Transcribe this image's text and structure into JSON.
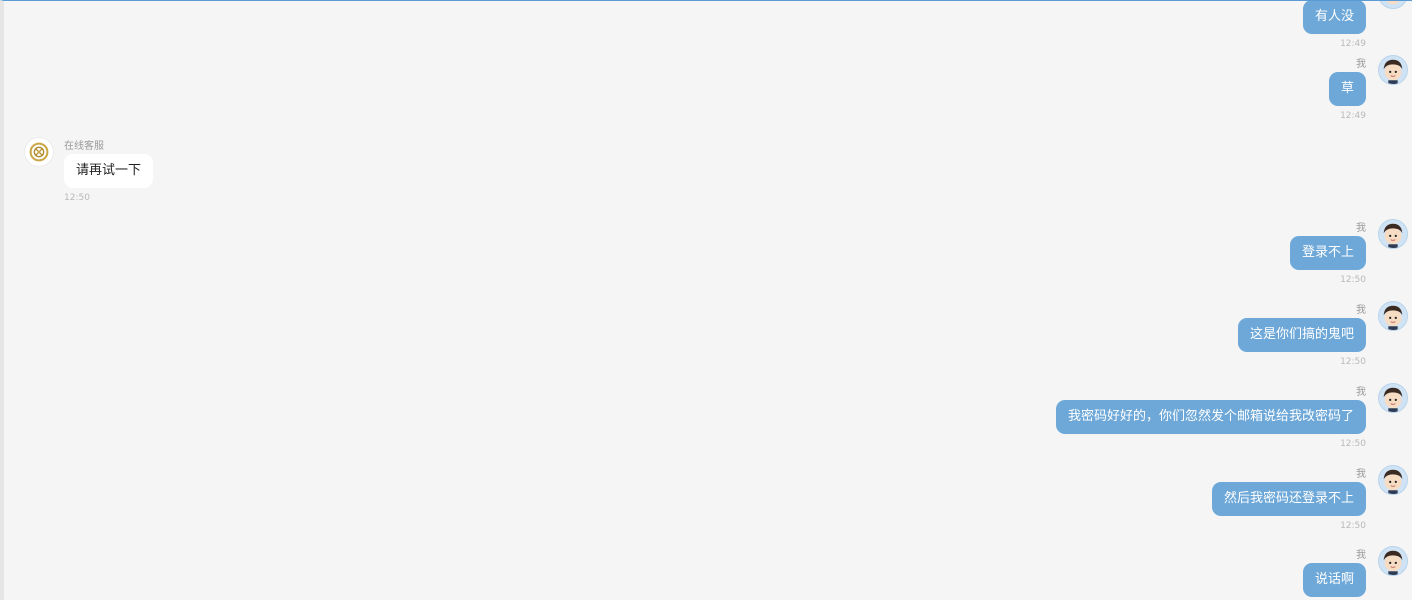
{
  "messages": [
    {
      "side": "out",
      "sender": "",
      "text": "有人没",
      "time": "12:49"
    },
    {
      "side": "out",
      "sender": "我",
      "text": "草",
      "time": "12:49"
    },
    {
      "side": "in",
      "sender": "在线客服",
      "text": "请再试一下",
      "time": "12:50"
    },
    {
      "side": "out",
      "sender": "我",
      "text": "登录不上",
      "time": "12:50"
    },
    {
      "side": "out",
      "sender": "我",
      "text": "这是你们搞的鬼吧",
      "time": "12:50"
    },
    {
      "side": "out",
      "sender": "我",
      "text": "我密码好好的，你们忽然发个邮箱说给我改密码了",
      "time": "12:50"
    },
    {
      "side": "out",
      "sender": "我",
      "text": "然后我密码还登录不上",
      "time": "12:50"
    },
    {
      "side": "out",
      "sender": "我",
      "text": "说话啊",
      "time": ""
    }
  ],
  "icons": {
    "user_avatar": "cartoon-boy-avatar",
    "service_avatar": "gold-emblem-logo"
  },
  "colors": {
    "outgoing_bubble": "#6ea8d8",
    "incoming_bubble": "#ffffff",
    "background": "#f5f5f5"
  }
}
